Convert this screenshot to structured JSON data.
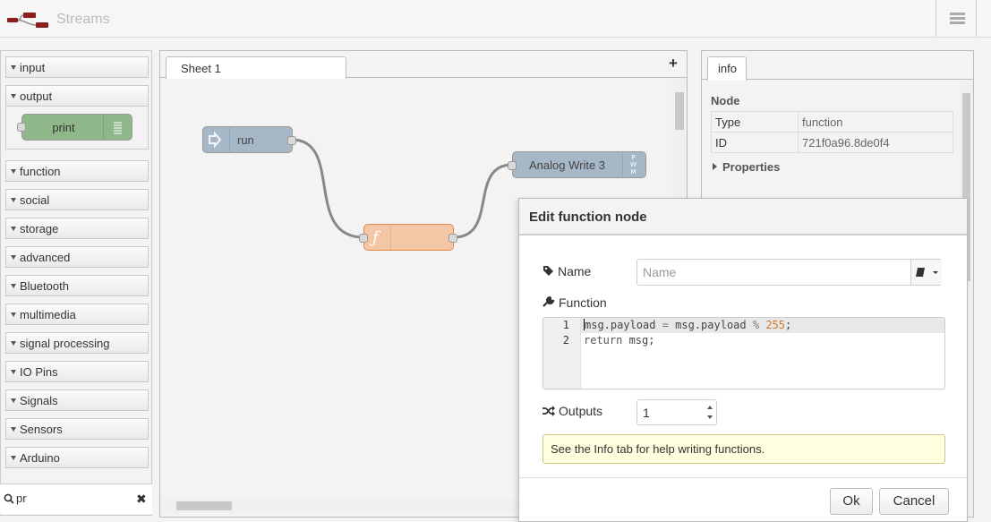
{
  "header": {
    "title": "Streams",
    "logo_icon": "flow-logo-icon",
    "menu_icon": "hamburger-menu-icon"
  },
  "palette": {
    "categories": [
      {
        "label": "input"
      },
      {
        "label": "output",
        "expanded": true
      },
      {
        "label": "function"
      },
      {
        "label": "social"
      },
      {
        "label": "storage"
      },
      {
        "label": "advanced"
      },
      {
        "label": "Bluetooth"
      },
      {
        "label": "multimedia"
      },
      {
        "label": "signal processing"
      },
      {
        "label": "IO Pins"
      },
      {
        "label": "Signals"
      },
      {
        "label": "Sensors"
      },
      {
        "label": "Arduino"
      }
    ],
    "output_node": {
      "label": "print",
      "color": "#8fb88a"
    },
    "search": {
      "value": "pr",
      "clear_icon": "close-icon"
    }
  },
  "workspace": {
    "tabs": [
      {
        "label": "Sheet 1"
      }
    ],
    "add_tab_label": "+",
    "nodes": {
      "run": {
        "label": "run",
        "color": "#a6b8c8"
      },
      "function": {
        "label": "",
        "color": "#f3c7a6",
        "icon": "function-icon"
      },
      "analog": {
        "label": "Analog Write 3",
        "color": "#a6b8c8",
        "icon": "pwm-icon",
        "icon_text": [
          "P",
          "W",
          "M"
        ]
      }
    }
  },
  "sidebar": {
    "tab_label": "info",
    "section_title": "Node",
    "rows": [
      {
        "key": "Type",
        "value": "function"
      },
      {
        "key": "ID",
        "value": "721f0a96.8de0f4"
      }
    ],
    "properties_label": "Properties"
  },
  "dialog": {
    "title": "Edit function node",
    "name_label": "Name",
    "name_value": "",
    "name_placeholder": "Name",
    "function_label": "Function",
    "code_lines": [
      {
        "num": "1",
        "parts": [
          "msg.payload ",
          "=",
          " msg.payload ",
          "%",
          " ",
          "255",
          ";"
        ]
      },
      {
        "num": "2",
        "parts": [
          "return",
          " msg;"
        ]
      }
    ],
    "outputs_label": "Outputs",
    "outputs_value": "1",
    "tip": "See the Info tab for help writing functions.",
    "ok_label": "Ok",
    "cancel_label": "Cancel"
  }
}
